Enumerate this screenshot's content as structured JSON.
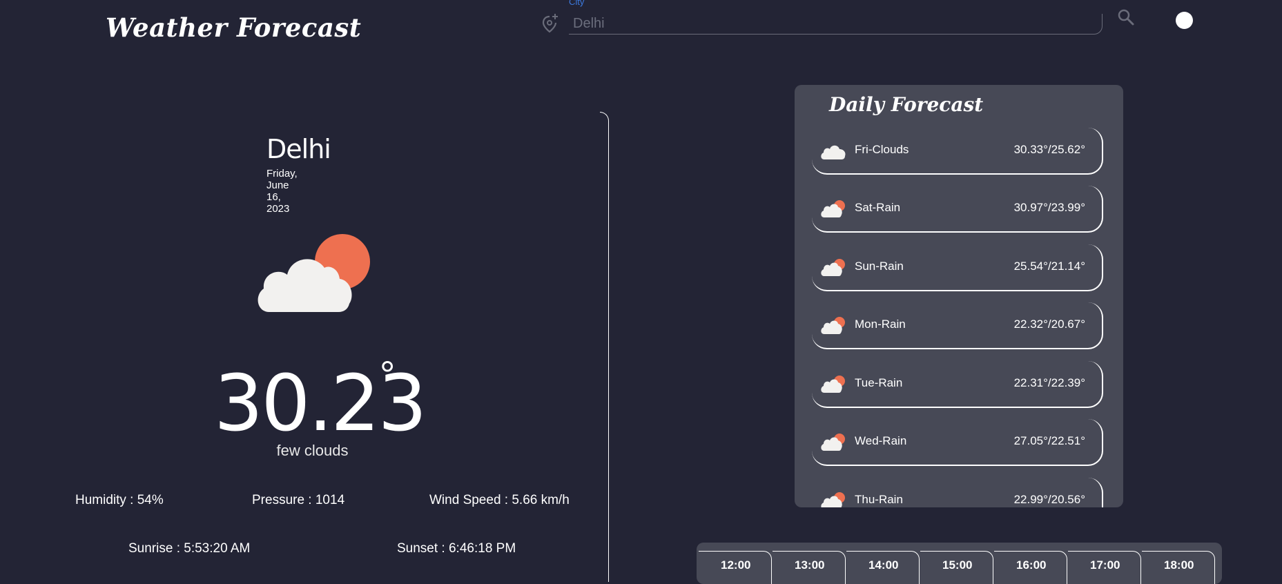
{
  "header": {
    "title": "Weather Forecast",
    "search": {
      "label": "City",
      "value": "Delhi",
      "placeholder": "Delhi"
    }
  },
  "current": {
    "city": "Delhi",
    "date": "Friday, June 16, 2023",
    "temperature": "30.23",
    "degree_symbol": "°",
    "description": "few clouds",
    "icon": "cloud-sun-icon",
    "humidity": "Humidity : 54%",
    "pressure": "Pressure : 1014",
    "wind": "Wind Speed : 5.66 km/h",
    "sunrise": "Sunrise : 5:53:20 AM",
    "sunset": "Sunset : 6:46:18 PM"
  },
  "daily": {
    "title": "Daily Forecast",
    "days": [
      {
        "label": "Fri-Clouds",
        "temps": "30.33°/25.62°",
        "icon": "cloud-icon"
      },
      {
        "label": "Sat-Rain",
        "temps": "30.97°/23.99°",
        "icon": "cloud-sun-icon"
      },
      {
        "label": "Sun-Rain",
        "temps": "25.54°/21.14°",
        "icon": "cloud-sun-icon"
      },
      {
        "label": "Mon-Rain",
        "temps": "22.32°/20.67°",
        "icon": "cloud-sun-icon"
      },
      {
        "label": "Tue-Rain",
        "temps": "22.31°/22.39°",
        "icon": "cloud-sun-icon"
      },
      {
        "label": "Wed-Rain",
        "temps": "27.05°/22.51°",
        "icon": "cloud-sun-icon"
      },
      {
        "label": "Thu-Rain",
        "temps": "22.99°/20.56°",
        "icon": "cloud-sun-icon"
      }
    ]
  },
  "hourly": {
    "hours": [
      "12:00",
      "13:00",
      "14:00",
      "15:00",
      "16:00",
      "17:00",
      "18:00"
    ]
  },
  "colors": {
    "background": "#232435",
    "panel": "#474956",
    "sun": "#ee7050",
    "cloud": "#f2f1ef",
    "accent": "#3d7be0"
  }
}
